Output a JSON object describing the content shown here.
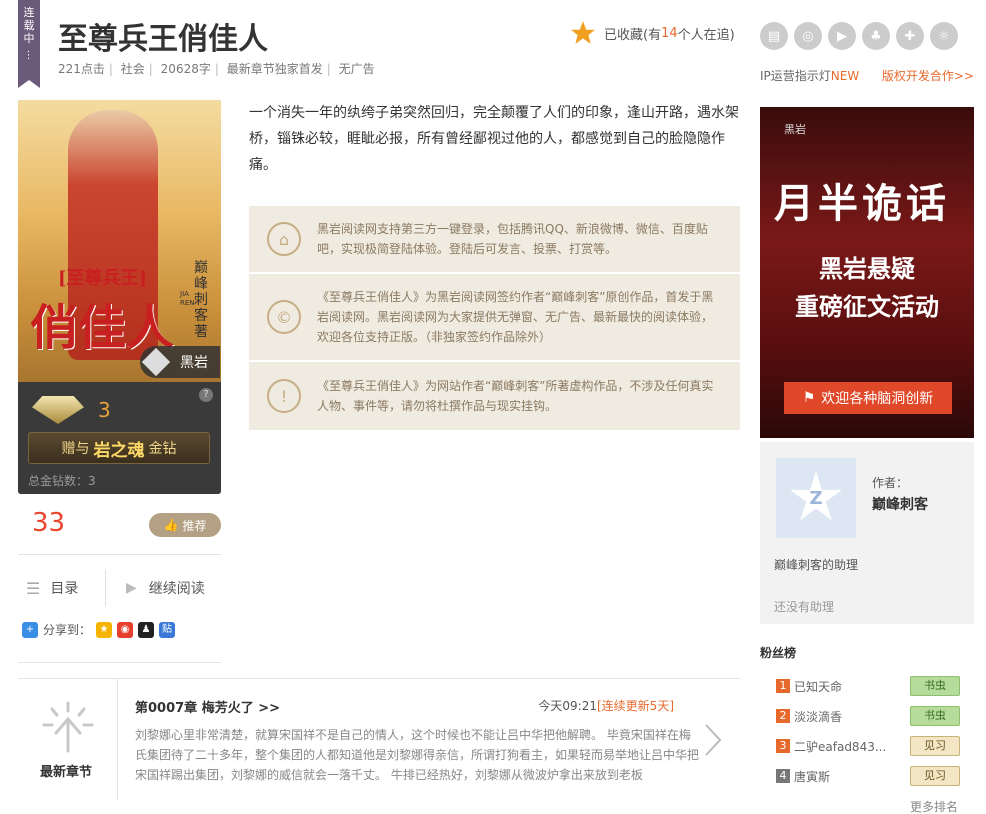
{
  "ribbon": {
    "status": "连载中"
  },
  "book": {
    "title": "至尊兵王俏佳人",
    "meta": [
      "221点击",
      "社会",
      "20628字",
      "最新章节独家首发",
      "无广告"
    ],
    "intro": "一个消失一年的纨绔子弟突然回归，完全颠覆了人们的印象，逢山开路，遇水架桥，锱铢必较，睚眦必报，所有曾经鄙视过他的人，都感觉到自己的脸隐隐作痛。"
  },
  "collect": {
    "prefix": "已收藏(有",
    "count": "14",
    "suffix": "个人在追)"
  },
  "top_icons": [
    "book-icon",
    "listen-icon",
    "play-icon",
    "mickey-icon",
    "gamepad-icon",
    "bulb-icon"
  ],
  "ip_line": {
    "label": "IP运营指示灯",
    "badge": "NEW",
    "copyright": "版权开发合作>>"
  },
  "cover": {
    "subtitle": "[至尊兵王]",
    "main_title": "俏佳人",
    "author_vertical": "巅峰刺客著",
    "pinyin": "JIA REN",
    "logo": "黑岩"
  },
  "gems": {
    "count": "3",
    "help": "?",
    "gift_pre": "赠与",
    "gift_big": "岩之魂",
    "gift_post": "金钻",
    "total": "总金钻数：3"
  },
  "recommend": {
    "count": "33",
    "label": "推荐"
  },
  "actions": {
    "toc": "目录",
    "continue": "继续阅读"
  },
  "share": {
    "label": "分享到：",
    "targets": [
      "qzone",
      "weibo",
      "qq",
      "tieba"
    ]
  },
  "notices": [
    {
      "icon": "lock-icon",
      "symbol": "⌂",
      "text": "黑岩阅读网支持第三方一键登录，包括腾讯QQ、新浪微博、微信、百度贴吧，实现极简登陆体验。登陆后可发言、投票、打赏等。"
    },
    {
      "icon": "copyright-icon",
      "symbol": "©",
      "text": "《至尊兵王俏佳人》为黑岩阅读网签约作者“巅峰刺客”原创作品，首发于黑岩阅读网。黑岩阅读网为大家提供无弹窗、无广告、最新最快的阅读体验，欢迎各位支持正版。（非独家签约作品除外）"
    },
    {
      "icon": "exclamation-icon",
      "symbol": "!",
      "text": "《至尊兵王俏佳人》为网站作者“巅峰刺客”所著虚构作品，不涉及任何真实人物、事件等，请勿将杜撰作品与现实挂钩。"
    }
  ],
  "ad": {
    "logo": "黑岩",
    "script": "月半诡话",
    "line1": "黑岩悬疑",
    "line2": "重磅征文活动",
    "button": "欢迎各种脑洞创新"
  },
  "author": {
    "label": "作者：",
    "name": "巅峰刺客",
    "avatar_glyph": "Z",
    "assistant": "巅峰刺客的助理",
    "no_assistant": "还没有助理"
  },
  "fans": {
    "title": "粉丝榜",
    "list": [
      {
        "rank": "1",
        "name": "已知天命",
        "level": "书虫"
      },
      {
        "rank": "2",
        "name": "淡淡滴香",
        "level": "书虫"
      },
      {
        "rank": "3",
        "name": "二驴eafad843...",
        "level": "见习"
      },
      {
        "rank": "4",
        "name": "唐寅斯",
        "level": "见习"
      }
    ],
    "more": "更多排名",
    "rank_colors": [
      "#e8692c",
      "#e8692c",
      "#e8692c",
      "#777777"
    ]
  },
  "latest": {
    "label": "最新章节",
    "chapter": "第0007章 梅芳火了 >>",
    "time": "今天09:21",
    "update": "[连续更新5天]",
    "excerpt": "刘黎娜心里非常清楚，就算宋国祥不是自己的情人，这个时候也不能让吕中华把他解聘。 毕竟宋国祥在梅氏集团待了二十多年，整个集团的人都知道他是刘黎娜得亲信，所谓打狗看主，如果轻而易举地让吕中华把宋国祥踢出集团，刘黎娜的威信就会一落千丈。 牛排已经热好，刘黎娜从微波炉拿出来放到老板"
  },
  "colors": {
    "accent": "#e8692c",
    "notice_bg": "#f0ebe0",
    "ribbon": "#6b5b7b"
  }
}
